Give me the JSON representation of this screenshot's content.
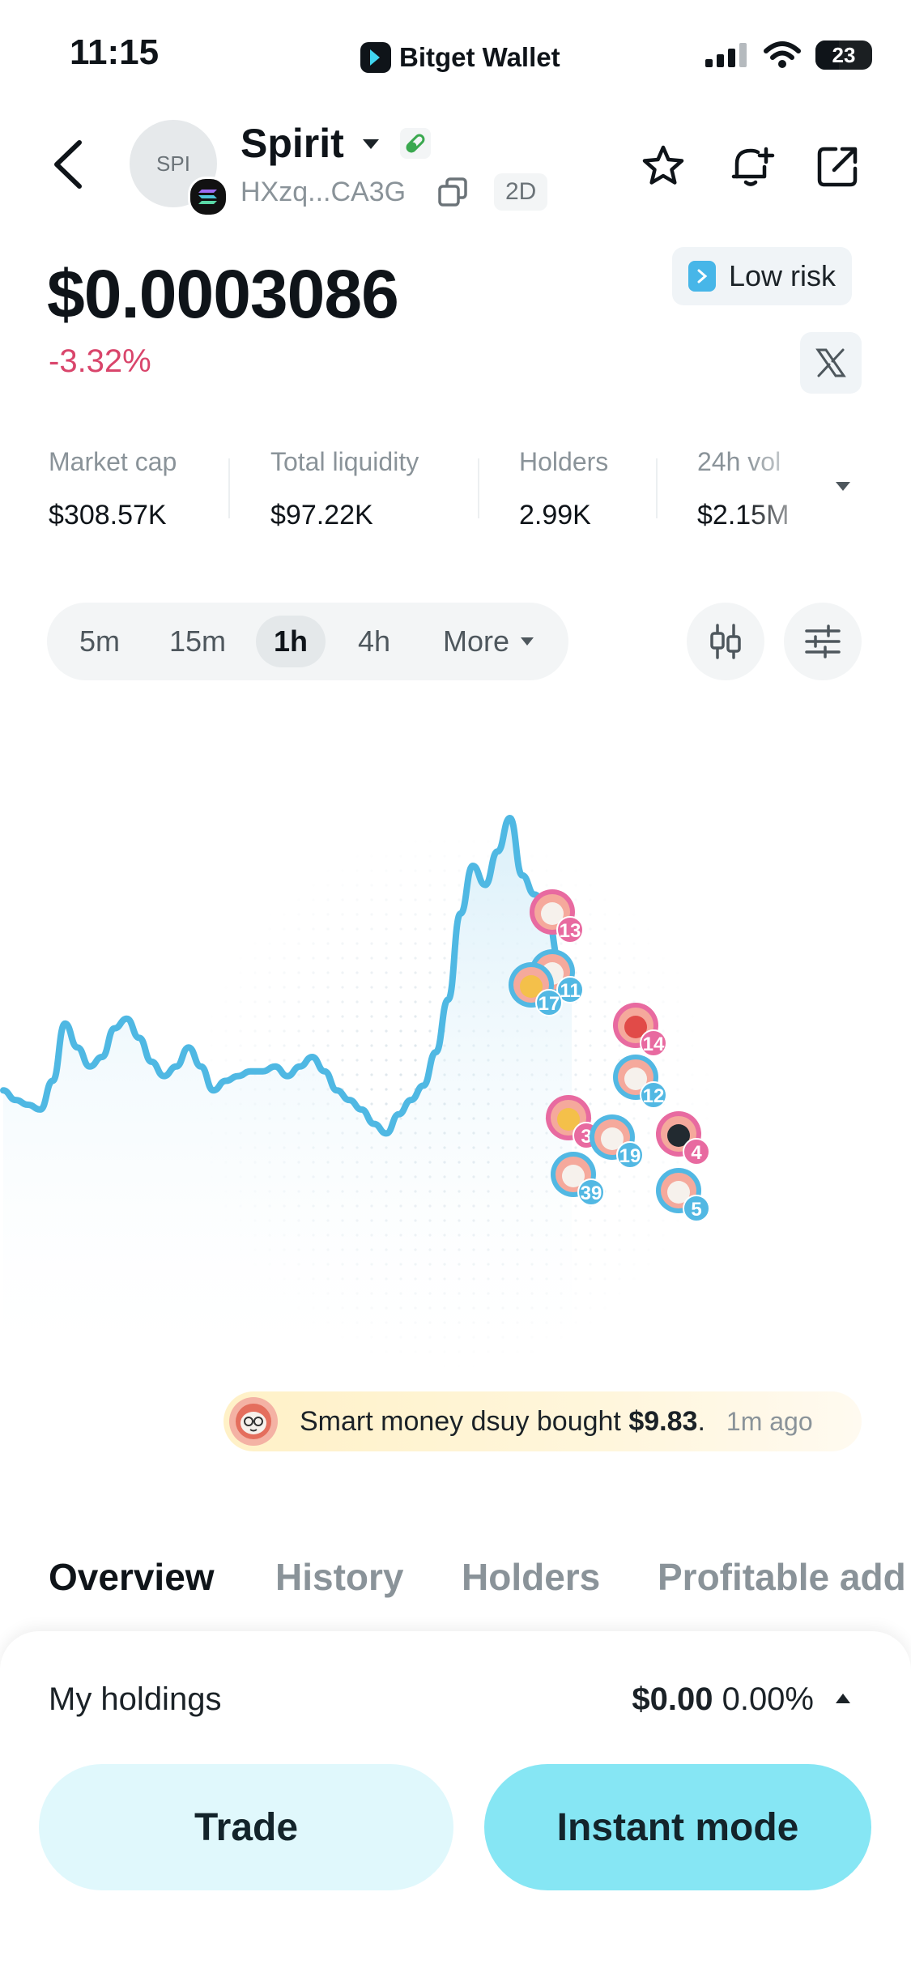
{
  "status_bar": {
    "time": "11:15",
    "app_name": "Bitget Wallet",
    "battery": "23"
  },
  "token": {
    "avatar_text": "SPI",
    "name": "Spirit",
    "address": "HXzq...CA3G",
    "age": "2D",
    "price": "$0.0003086",
    "change": "-3.32%",
    "risk": "Low risk",
    "colors": {
      "change_negative": "#d9456b",
      "line": "#4fb8e3",
      "risk_icon": "#47b6e8"
    }
  },
  "stats": [
    {
      "label": "Market cap",
      "value": "$308.57K"
    },
    {
      "label": "Total liquidity",
      "value": "$97.22K"
    },
    {
      "label": "Holders",
      "value": "2.99K"
    },
    {
      "label": "24h vol",
      "value": "$2.15M"
    }
  ],
  "intervals": [
    "5m",
    "15m",
    "1h",
    "4h",
    "More"
  ],
  "active_interval": "1h",
  "chart_data": {
    "type": "line",
    "series": [
      {
        "values": [
          0.43,
          0.41,
          0.4,
          0.39,
          0.45,
          0.57,
          0.52,
          0.48,
          0.5,
          0.56,
          0.58,
          0.54,
          0.49,
          0.46,
          0.48,
          0.52,
          0.48,
          0.43,
          0.45,
          0.46,
          0.47,
          0.47,
          0.48,
          0.46,
          0.48,
          0.5,
          0.47,
          0.43,
          0.41,
          0.39,
          0.36,
          0.34,
          0.38,
          0.41,
          0.44,
          0.51,
          0.62,
          0.8,
          0.9,
          0.86,
          0.93,
          1.0,
          0.88,
          0.84,
          0.8,
          0.7,
          0.63
        ]
      }
    ],
    "trade_markers": [
      "13",
      "11",
      "17",
      "14",
      "12",
      "3",
      "19",
      "4",
      "39",
      "5"
    ]
  },
  "smart_money": {
    "prefix": "Smart money dsuy bought",
    "amount": "$9.83",
    "suffix": ".",
    "time": "1m ago"
  },
  "tabs": [
    "Overview",
    "History",
    "Holders",
    "Profitable add"
  ],
  "holdings": {
    "label": "My holdings",
    "value": "$0.00",
    "percent": "0.00%"
  },
  "buttons": {
    "trade": "Trade",
    "instant": "Instant mode"
  }
}
